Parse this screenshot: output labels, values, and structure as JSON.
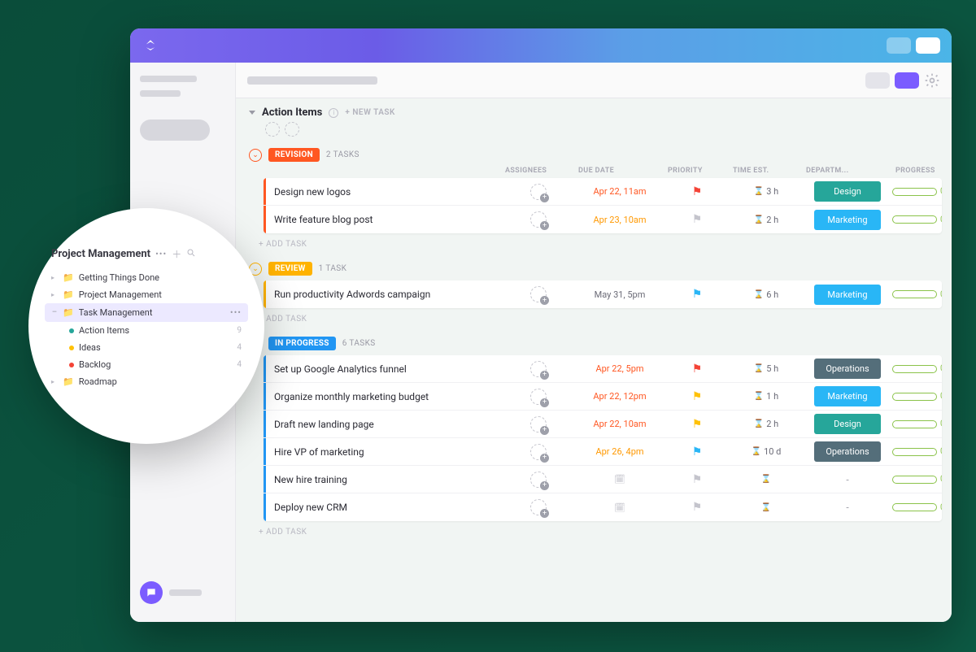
{
  "section": {
    "title": "Action Items",
    "newtask": "+ NEW TASK"
  },
  "columns": {
    "assignees": "ASSIGNEES",
    "duedate": "DUE DATE",
    "priority": "PRIORITY",
    "timeest": "TIME EST.",
    "department": "DEPARTM...",
    "progress": "PROGRESS"
  },
  "addtask": "+ ADD TASK",
  "groups": [
    {
      "id": "revision",
      "label": "REVISION",
      "count": "2 TASKS",
      "tasks": [
        {
          "name": "Design new logos",
          "due": "Apr 22, 11am",
          "dueClass": "due-red",
          "flag": "flag-red",
          "time": "3 h",
          "dept": "Design",
          "deptClass": "dept-design",
          "progress": "0%"
        },
        {
          "name": "Write feature blog post",
          "due": "Apr 23, 10am",
          "dueClass": "due-orange",
          "flag": "flag-gray",
          "time": "2 h",
          "dept": "Marketing",
          "deptClass": "dept-marketing",
          "progress": "0%"
        }
      ]
    },
    {
      "id": "review",
      "label": "REVIEW",
      "count": "1 TASK",
      "tasks": [
        {
          "name": "Run productivity Adwords campaign",
          "due": "May 31, 5pm",
          "dueClass": "due-normal",
          "flag": "flag-blue",
          "time": "6 h",
          "dept": "Marketing",
          "deptClass": "dept-marketing",
          "progress": "0%"
        }
      ]
    },
    {
      "id": "inprogress",
      "label": "IN PROGRESS",
      "count": "6 TASKS",
      "tasks": [
        {
          "name": "Set up Google Analytics funnel",
          "due": "Apr 22, 5pm",
          "dueClass": "due-red",
          "flag": "flag-red",
          "time": "5 h",
          "dept": "Operations",
          "deptClass": "dept-operations",
          "progress": "0%"
        },
        {
          "name": "Organize monthly marketing budget",
          "due": "Apr 22, 12pm",
          "dueClass": "due-red",
          "flag": "flag-yellow",
          "time": "1 h",
          "dept": "Marketing",
          "deptClass": "dept-marketing",
          "progress": "0%"
        },
        {
          "name": "Draft new landing page",
          "due": "Apr 22, 10am",
          "dueClass": "due-red",
          "flag": "flag-yellow",
          "time": "2 h",
          "dept": "Design",
          "deptClass": "dept-design",
          "progress": "0%"
        },
        {
          "name": "Hire VP of marketing",
          "due": "Apr 26, 4pm",
          "dueClass": "due-orange",
          "flag": "flag-blue",
          "time": "10 d",
          "dept": "Operations",
          "deptClass": "dept-operations",
          "progress": "0%"
        },
        {
          "name": "New hire training",
          "due": "",
          "dueClass": "",
          "flag": "flag-gray",
          "time": "",
          "dept": "-",
          "deptClass": "",
          "progress": "0%"
        },
        {
          "name": "Deploy new CRM",
          "due": "",
          "dueClass": "",
          "flag": "flag-gray",
          "time": "",
          "dept": "-",
          "deptClass": "",
          "progress": "0%"
        }
      ]
    }
  ],
  "bubble": {
    "title": "Project Management",
    "items": [
      {
        "label": "Getting Things Done"
      },
      {
        "label": "Project Management"
      },
      {
        "label": "Task Management",
        "active": true,
        "sub": [
          {
            "label": "Action Items",
            "count": "9",
            "dot": "dot-green"
          },
          {
            "label": "Ideas",
            "count": "4",
            "dot": "dot-yellow"
          },
          {
            "label": "Backlog",
            "count": "4",
            "dot": "dot-red"
          }
        ]
      },
      {
        "label": "Roadmap"
      }
    ]
  }
}
